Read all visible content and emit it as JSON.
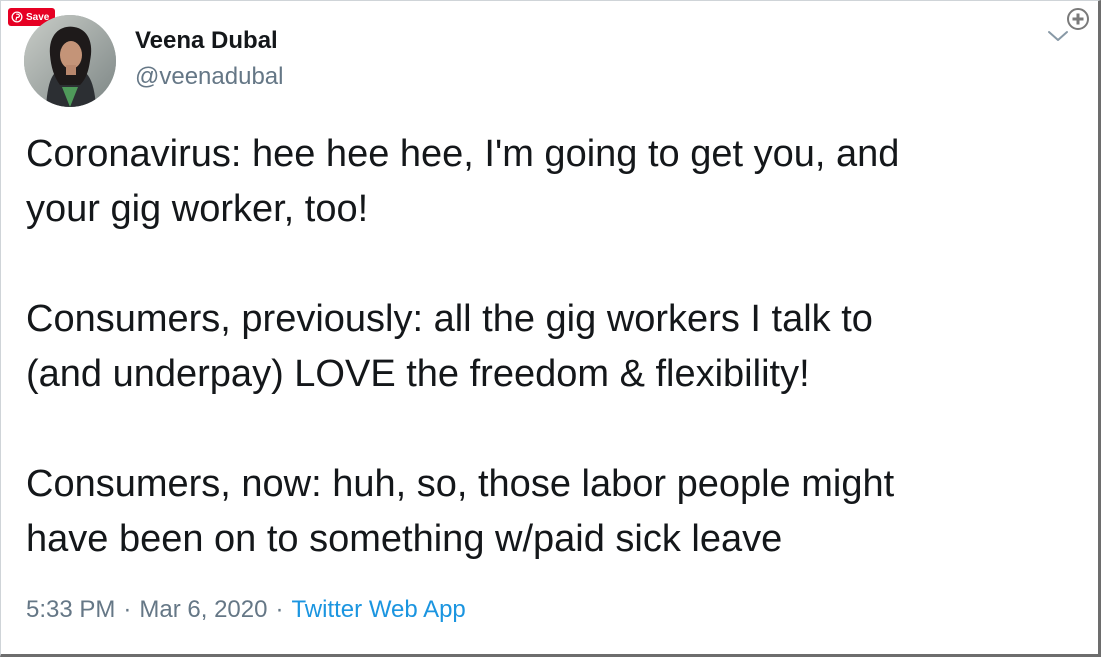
{
  "pin_button": {
    "label": "Save",
    "color": "#e60023"
  },
  "author": {
    "display_name": "Veena Dubal",
    "handle": "@veenadubal"
  },
  "tweet": {
    "lines": [
      [
        "Coronavirus:  hee hee hee, I'm going to get you, and",
        "your gig worker, too!"
      ],
      [
        "Consumers, previously: all the gig workers I talk to",
        "(and underpay) LOVE the freedom & flexibility!"
      ],
      [
        "Consumers, now: huh, so, those labor people might",
        "have been on to something w/paid sick leave"
      ]
    ]
  },
  "meta": {
    "time": "5:33 PM",
    "separator": "·",
    "date": "Mar 6, 2020",
    "source": "Twitter Web App"
  },
  "colors": {
    "text": "#14171a",
    "secondary": "#657786",
    "link": "#1b95e0"
  },
  "icons": [
    "pinterest-icon",
    "chevron-down-icon",
    "zoom-in-icon"
  ]
}
